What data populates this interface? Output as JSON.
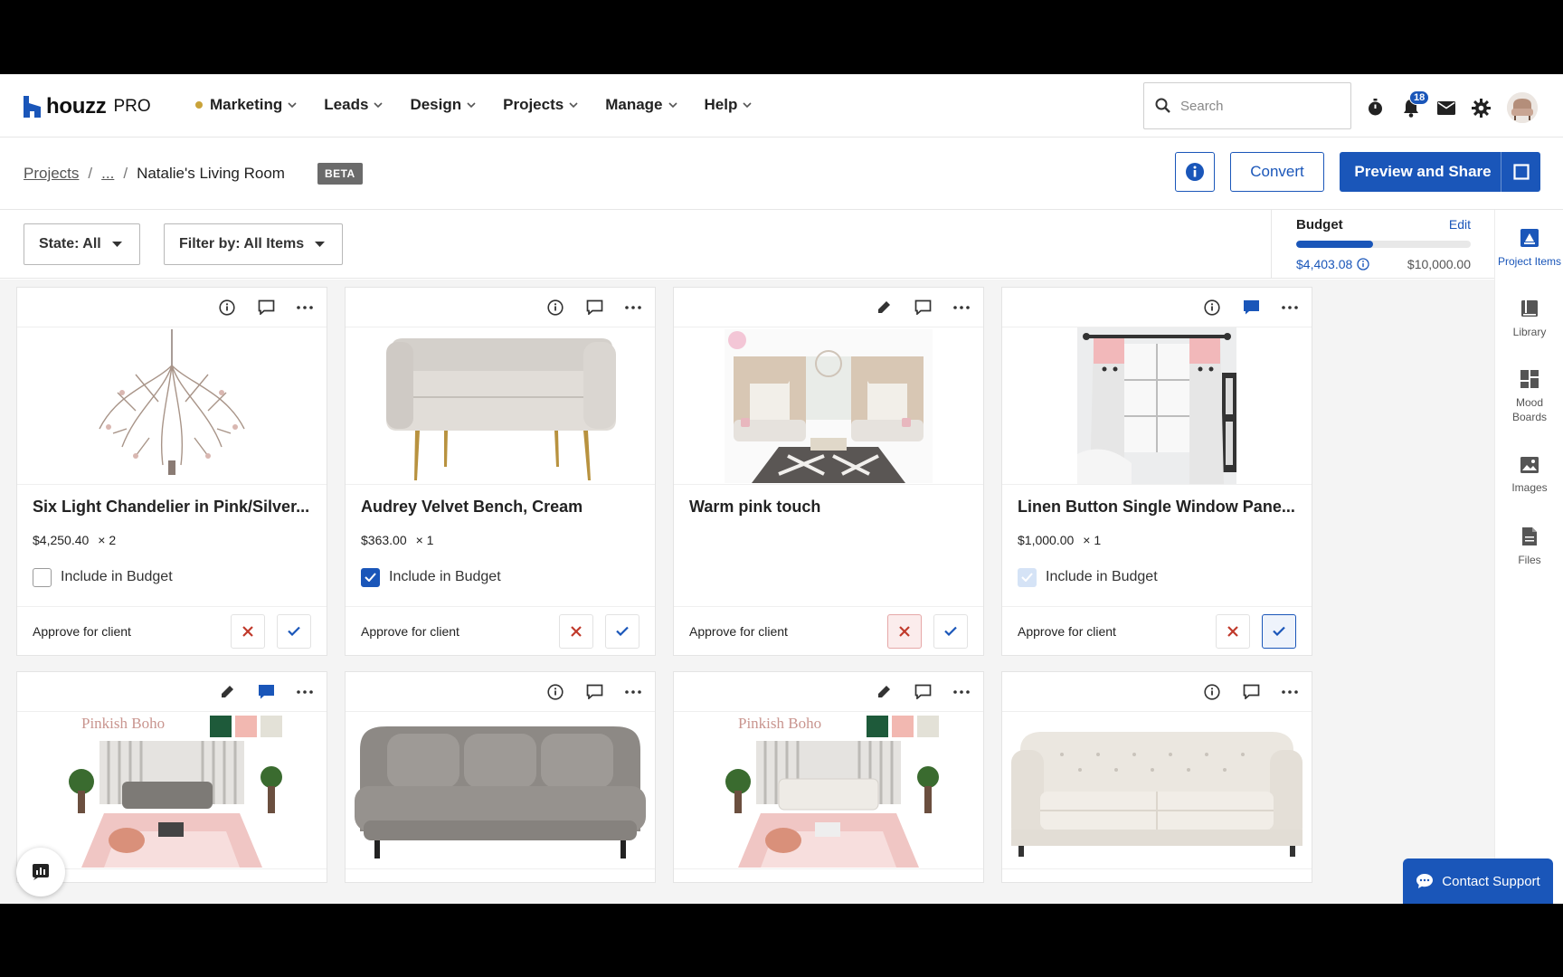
{
  "brand": {
    "name": "houzz",
    "suffix": "PRO"
  },
  "nav": [
    {
      "label": "Marketing",
      "dot": true
    },
    {
      "label": "Leads"
    },
    {
      "label": "Design"
    },
    {
      "label": "Projects"
    },
    {
      "label": "Manage"
    },
    {
      "label": "Help"
    }
  ],
  "search": {
    "placeholder": "Search",
    "value": ""
  },
  "notifications": {
    "count": "18"
  },
  "breadcrumb": {
    "root": "Projects",
    "ellipsis": "...",
    "separator": "/",
    "current": "Natalie's Living Room",
    "badge": "BETA"
  },
  "actions": {
    "convert": "Convert",
    "share": "Preview and Share"
  },
  "filters": {
    "state": "State: All",
    "filter": "Filter by: All Items"
  },
  "budget": {
    "label": "Budget",
    "edit": "Edit",
    "spent": "$4,403.08",
    "total": "$10,000.00",
    "fraction": 0.44
  },
  "sidebar": {
    "items": [
      {
        "label": "Project Items",
        "icon": "project-items-icon",
        "active": true
      },
      {
        "label": "Library",
        "icon": "library-icon"
      },
      {
        "label": "Mood Boards",
        "icon": "mood-boards-icon"
      },
      {
        "label": "Images",
        "icon": "images-icon"
      },
      {
        "label": "Files",
        "icon": "files-icon"
      }
    ]
  },
  "cards": [
    {
      "title": "Six Light Chandelier in Pink/Silver...",
      "price": "$4,250.40",
      "qty": "× 2",
      "budget_label": "Include in Budget",
      "approve_label": "Approve for client",
      "include": "unchecked",
      "approval": "none",
      "top_icons": [
        "info-icon",
        "comment-icon",
        "more-icon"
      ],
      "image": "chandelier"
    },
    {
      "title": "Audrey Velvet Bench, Cream",
      "price": "$363.00",
      "qty": "× 1",
      "budget_label": "Include in Budget",
      "approve_label": "Approve for client",
      "include": "checked",
      "approval": "none",
      "top_icons": [
        "info-icon",
        "comment-icon",
        "more-icon"
      ],
      "image": "bench"
    },
    {
      "title": "Warm pink touch",
      "price": "",
      "qty": "",
      "budget_label": "",
      "approve_label": "Approve for client",
      "include": "none",
      "approval": "rejected",
      "top_icons": [
        "pencil-icon",
        "comment-icon",
        "more-icon"
      ],
      "image": "room"
    },
    {
      "title": "Linen Button Single Window Pane...",
      "price": "$1,000.00",
      "qty": "× 1",
      "budget_label": "Include in Budget",
      "approve_label": "Approve for client",
      "include": "faded",
      "approval": "approved",
      "top_icons": [
        "info-icon",
        "comment-filled-icon",
        "more-icon"
      ],
      "image": "curtain"
    },
    {
      "title": "",
      "top_icons": [
        "pencil-icon",
        "comment-filled-icon",
        "more-icon"
      ],
      "image": "moodboard",
      "board_title": "Pinkish Boho"
    },
    {
      "title": "",
      "top_icons": [
        "info-icon",
        "comment-icon",
        "more-icon"
      ],
      "image": "sofa-grey"
    },
    {
      "title": "",
      "top_icons": [
        "pencil-icon",
        "comment-icon",
        "more-icon"
      ],
      "image": "moodboard2",
      "board_title": "Pinkish Boho"
    },
    {
      "title": "",
      "top_icons": [
        "info-icon",
        "comment-icon",
        "more-icon"
      ],
      "image": "sofa-white"
    }
  ],
  "support": {
    "label": "Contact Support"
  },
  "colors": {
    "accent": "#1a56b9",
    "reject": "#c0392b",
    "beta": "#6b6b6b"
  }
}
